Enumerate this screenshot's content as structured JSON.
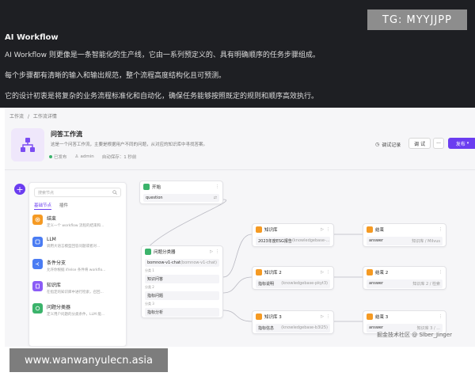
{
  "header": {
    "title": "AI Workflow",
    "para1": "AI Workflow 则更像是一条智能化的生产线，它由一系列预定义的、具有明确顺序的任务步骤组成。",
    "para2": "每个步骤都有清晰的输入和输出规范，整个流程高度结构化且可预测。",
    "para3": "它的设计初衷是将复杂的业务流程标准化和自动化，确保任务能够按照既定的规则和顺序高效执行。"
  },
  "overlay": {
    "tg": "TG: MYYJJPP",
    "site": "www.wanwanyulecn.asia",
    "watermark": "掘金技术社区 @ Slber_Jinger"
  },
  "breadcrumb": {
    "root": "工作流",
    "sep": "/",
    "current": "工作流详情"
  },
  "workflow": {
    "name": "问答工作流",
    "desc": "这是一个问答工作流，主要是根据用户不同的问题，从对应的知识库中寻找答案。",
    "status": "已发布",
    "owner": "admin",
    "autosave": "自动保存：1 秒前"
  },
  "actions": {
    "log": "调试记录",
    "debug": "调 试",
    "more": "···",
    "publish": "发布"
  },
  "panel": {
    "search_placeholder": "搜索节点",
    "tabs": [
      "基础节点",
      "插件"
    ],
    "items": [
      {
        "name": "结束",
        "desc": "定义一个 workflow 流程的结束和..."
      },
      {
        "name": "LLM",
        "desc": "调用大语言模型回答问题或者对..."
      },
      {
        "name": "条件分支",
        "desc": "允许你根据 if/else 条件将 workflo..."
      },
      {
        "name": "知识库",
        "desc": "在指定的知识库中进行检索，召回..."
      },
      {
        "name": "问题分类器",
        "desc": "定义用户问题的分类条件，LLM 能..."
      }
    ]
  },
  "nodes": {
    "start": {
      "title": "开始",
      "field": "question",
      "more": "⋮"
    },
    "classifier": {
      "title": "问题分类器",
      "model": "bomnow-v1-chat",
      "model_tag": "(bomnow-v1-chat)",
      "cls1_label": "分类 1",
      "cls1": "知识问答",
      "cls2_label": "分类 2",
      "cls2": "指标问题",
      "cls3_label": "分类 3",
      "cls3": "指标分析"
    },
    "kb1": {
      "title": "知识库",
      "row": "2023年度ESG报告",
      "tag": "(knowledgebase-..."
    },
    "kb2": {
      "title": "知识库 2",
      "row": "指标说明",
      "tag": "(knowledgebase-pkyt3)"
    },
    "kb3": {
      "title": "知识库 3",
      "row": "指标信息",
      "tag": "(knowledgebase-b3l25)"
    },
    "end1": {
      "title": "结束",
      "row": "answer",
      "tag": "知识库 / Milvus"
    },
    "end2": {
      "title": "结束 2",
      "row": "answer",
      "tag": "知识库 2 / 检索"
    },
    "end3": {
      "title": "结束 3",
      "row": "answer",
      "tag": "知识库 3 / ..."
    }
  },
  "colors": {
    "accent": "#6b3df0",
    "orange": "#f59a23",
    "green": "#3bb36b",
    "purple": "#8b5cf6",
    "blue": "#4a7cf3",
    "dark": "#1e1f23"
  }
}
